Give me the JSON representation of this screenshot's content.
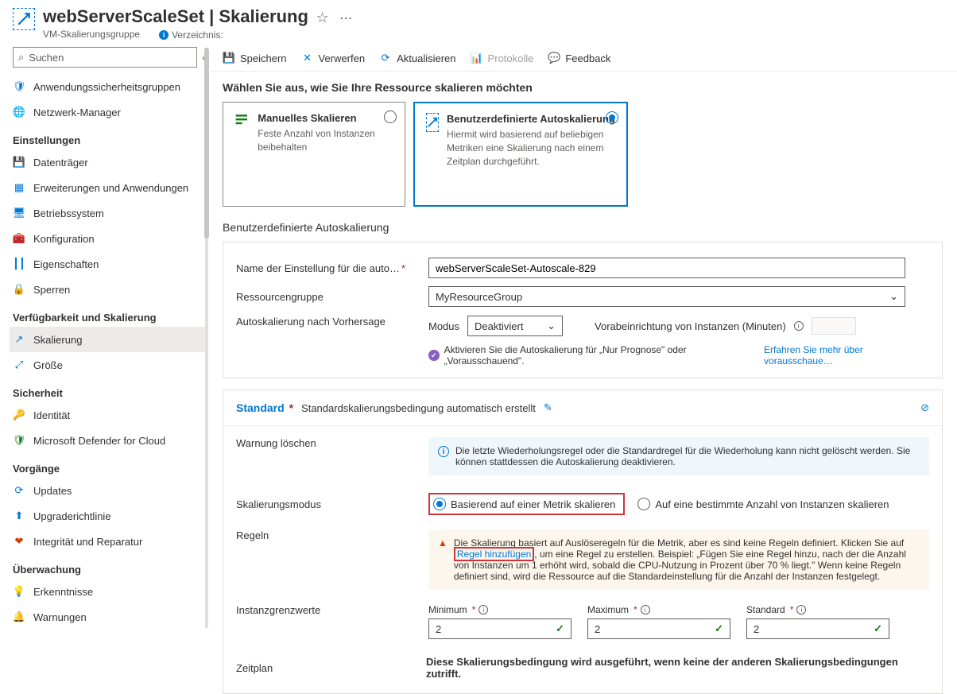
{
  "header": {
    "title": "webServerScaleSet | Skalierung",
    "subtitle": "VM-Skalierungsgruppe",
    "directory_label": "Verzeichnis:"
  },
  "sidebar": {
    "search_placeholder": "Suchen",
    "items_top": [
      {
        "label": "Anwendungssicherheitsgruppen"
      },
      {
        "label": "Netzwerk-Manager"
      }
    ],
    "group_settings": "Einstellungen",
    "items_settings": [
      {
        "label": "Datenträger"
      },
      {
        "label": "Erweiterungen und Anwendungen"
      },
      {
        "label": "Betriebssystem"
      },
      {
        "label": "Konfiguration"
      },
      {
        "label": "Eigenschaften"
      },
      {
        "label": "Sperren"
      }
    ],
    "group_avail": "Verfügbarkeit und Skalierung",
    "items_avail": [
      {
        "label": "Skalierung"
      },
      {
        "label": "Größe"
      }
    ],
    "group_security": "Sicherheit",
    "items_security": [
      {
        "label": "Identität"
      },
      {
        "label": "Microsoft Defender for Cloud"
      }
    ],
    "group_ops": "Vorgänge",
    "items_ops": [
      {
        "label": "Updates"
      },
      {
        "label": "Upgraderichtlinie"
      },
      {
        "label": "Integrität und Reparatur"
      }
    ],
    "group_monitor": "Überwachung",
    "items_monitor": [
      {
        "label": "Erkenntnisse"
      },
      {
        "label": "Warnungen"
      }
    ]
  },
  "toolbar": {
    "save": "Speichern",
    "discard": "Verwerfen",
    "refresh": "Aktualisieren",
    "logs": "Protokolle",
    "feedback": "Feedback"
  },
  "scale_choice": {
    "heading": "Wählen Sie aus, wie Sie Ihre Ressource skalieren möchten",
    "manual_title": "Manuelles Skalieren",
    "manual_desc": "Feste Anzahl von Instanzen beibehalten",
    "custom_title": "Benutzerdefinierte Autoskalierung",
    "custom_desc": "Hiermit wird basierend auf beliebigen Metriken eine Skalierung nach einem Zeitplan durchgeführt."
  },
  "custom_section": {
    "title": "Benutzerdefinierte Autoskalierung",
    "name_label": "Name der Einstellung für die auto…",
    "name_value": "webServerScaleSet-Autoscale-829",
    "rg_label": "Ressourcengruppe",
    "rg_value": "MyResourceGroup",
    "predict_label": "Autoskalierung nach Vorhersage",
    "mode_label": "Modus",
    "mode_value": "Deaktiviert",
    "preprov_label": "Vorabeinrichtung von Instanzen (Minuten)",
    "predict_note": "Aktivieren Sie die Autoskalierung für „Nur Prognose\" oder „Vorausschauend\".",
    "predict_link": "Erfahren Sie mehr über vorausschaue…"
  },
  "standard": {
    "title": "Standard",
    "desc": "Standardskalierungsbedingung automatisch erstellt",
    "delete_label": "Warnung löschen",
    "delete_info": "Die letzte Wiederholungsregel oder die Standardregel für die Wiederholung kann nicht gelöscht werden. Sie können stattdessen die Autoskalierung deaktivieren.",
    "mode_label": "Skalierungsmodus",
    "mode_opt1": "Basierend auf einer Metrik skalieren",
    "mode_opt2": "Auf eine bestimmte Anzahl von Instanzen skalieren",
    "rules_label": "Regeln",
    "rules_warn_1": "Die Skalierung basiert auf Auslöseregeln für die Metrik, aber es sind keine Regeln definiert. Klicken Sie auf ",
    "rules_link": "Regel hinzufügen",
    "rules_warn_2": ", um eine Regel zu erstellen. Beispiel: „Fügen Sie eine Regel hinzu, nach der die Anzahl von Instanzen um 1 erhöht wird, sobald die CPU-Nutzung in Prozent über 70 % liegt.\" Wenn keine Regeln definiert sind, wird die Ressource auf die Standardeinstellung für die Anzahl der Instanzen festgelegt.",
    "limits_label": "Instanzgrenzwerte",
    "min_label": "Minimum",
    "max_label": "Maximum",
    "std_label": "Standard",
    "min_value": "2",
    "max_value": "2",
    "std_value": "2",
    "schedule_label": "Zeitplan",
    "schedule_note": "Diese Skalierungsbedingung wird ausgeführt, wenn keine der anderen Skalierungsbedingungen zutrifft."
  }
}
